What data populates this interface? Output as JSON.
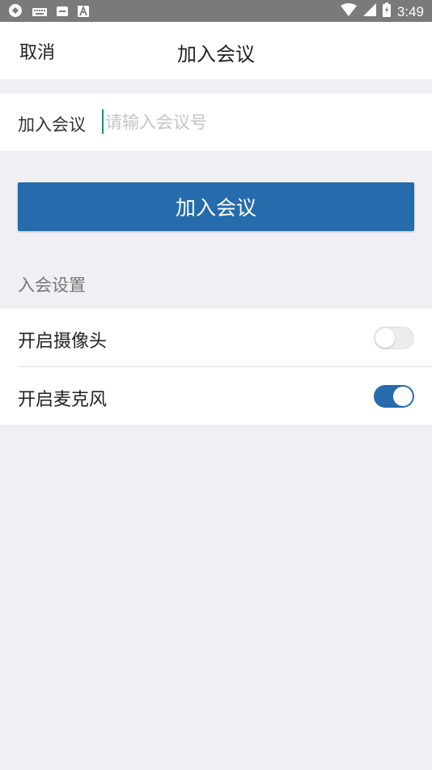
{
  "status_bar": {
    "time": "3:49",
    "left_icons": [
      "sync-icon",
      "keyboard-icon",
      "mail-icon",
      "a-icon"
    ],
    "right_icons": [
      "wifi-icon",
      "signal-icon",
      "battery-icon"
    ]
  },
  "nav": {
    "cancel_label": "取消",
    "title": "加入会议"
  },
  "meeting_input": {
    "label": "加入会议",
    "placeholder": "请输入会议号",
    "value": ""
  },
  "join_button_label": "加入会议",
  "settings": {
    "header": "入会设置",
    "items": [
      {
        "label": "开启摄像头",
        "enabled": false
      },
      {
        "label": "开启麦克风",
        "enabled": true
      }
    ]
  },
  "colors": {
    "accent": "#266bac",
    "background": "#efeff4",
    "status_bar": "#7a7a7a"
  }
}
